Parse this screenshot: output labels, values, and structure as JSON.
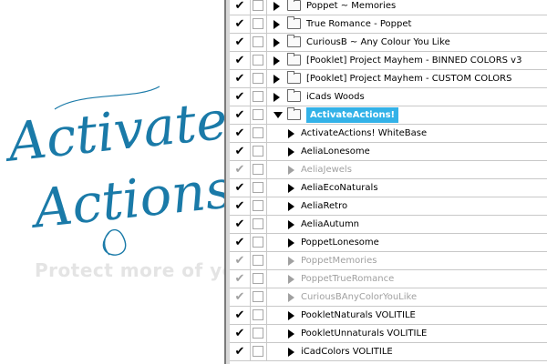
{
  "logo": {
    "line1": "Activate",
    "line2": "Actions!",
    "color": "#1a7aa8"
  },
  "watermark": {
    "text": "Protect more of your memories for less!"
  },
  "colors": {
    "selected_bg": "#33b2e8",
    "dim_text": "#a0a0a0"
  },
  "actions_panel": {
    "rows": [
      {
        "label": "Poppet ~ Memories",
        "type": "set",
        "checked": true,
        "dim": false,
        "expanded": false,
        "selected": false
      },
      {
        "label": "True Romance - Poppet",
        "type": "set",
        "checked": true,
        "dim": false,
        "expanded": false,
        "selected": false
      },
      {
        "label": "CuriousB ~ Any Colour You Like",
        "type": "set",
        "checked": true,
        "dim": false,
        "expanded": false,
        "selected": false
      },
      {
        "label": "[Pooklet] Project Mayhem - BINNED COLORS v3",
        "type": "set",
        "checked": true,
        "dim": false,
        "expanded": false,
        "selected": false
      },
      {
        "label": "[Pooklet] Project Mayhem - CUSTOM COLORS",
        "type": "set",
        "checked": true,
        "dim": false,
        "expanded": false,
        "selected": false
      },
      {
        "label": "iCads Woods",
        "type": "set",
        "checked": true,
        "dim": false,
        "expanded": false,
        "selected": false
      },
      {
        "label": "ActivateActions!",
        "type": "set",
        "checked": true,
        "dim": false,
        "expanded": true,
        "selected": true
      },
      {
        "label": "ActivateActions! WhiteBase",
        "type": "action",
        "checked": true,
        "dim": false,
        "expanded": false,
        "selected": false
      },
      {
        "label": "AeliaLonesome",
        "type": "action",
        "checked": true,
        "dim": false,
        "expanded": false,
        "selected": false
      },
      {
        "label": "AeliaJewels",
        "type": "action",
        "checked": true,
        "dim": true,
        "expanded": false,
        "selected": false
      },
      {
        "label": "AeliaEcoNaturals",
        "type": "action",
        "checked": true,
        "dim": false,
        "expanded": false,
        "selected": false
      },
      {
        "label": "AeliaRetro",
        "type": "action",
        "checked": true,
        "dim": false,
        "expanded": false,
        "selected": false
      },
      {
        "label": "AeliaAutumn",
        "type": "action",
        "checked": true,
        "dim": false,
        "expanded": false,
        "selected": false
      },
      {
        "label": "PoppetLonesome",
        "type": "action",
        "checked": true,
        "dim": false,
        "expanded": false,
        "selected": false
      },
      {
        "label": "PoppetMemories",
        "type": "action",
        "checked": true,
        "dim": true,
        "expanded": false,
        "selected": false
      },
      {
        "label": "PoppetTrueRomance",
        "type": "action",
        "checked": true,
        "dim": true,
        "expanded": false,
        "selected": false
      },
      {
        "label": "CuriousBAnyColorYouLike",
        "type": "action",
        "checked": true,
        "dim": true,
        "expanded": false,
        "selected": false
      },
      {
        "label": "PookletNaturals VOLITILE",
        "type": "action",
        "checked": true,
        "dim": false,
        "expanded": false,
        "selected": false
      },
      {
        "label": "PookletUnnaturals VOLITILE",
        "type": "action",
        "checked": true,
        "dim": false,
        "expanded": false,
        "selected": false
      },
      {
        "label": "iCadColors VOLITILE",
        "type": "action",
        "checked": true,
        "dim": false,
        "expanded": false,
        "selected": false
      }
    ]
  }
}
